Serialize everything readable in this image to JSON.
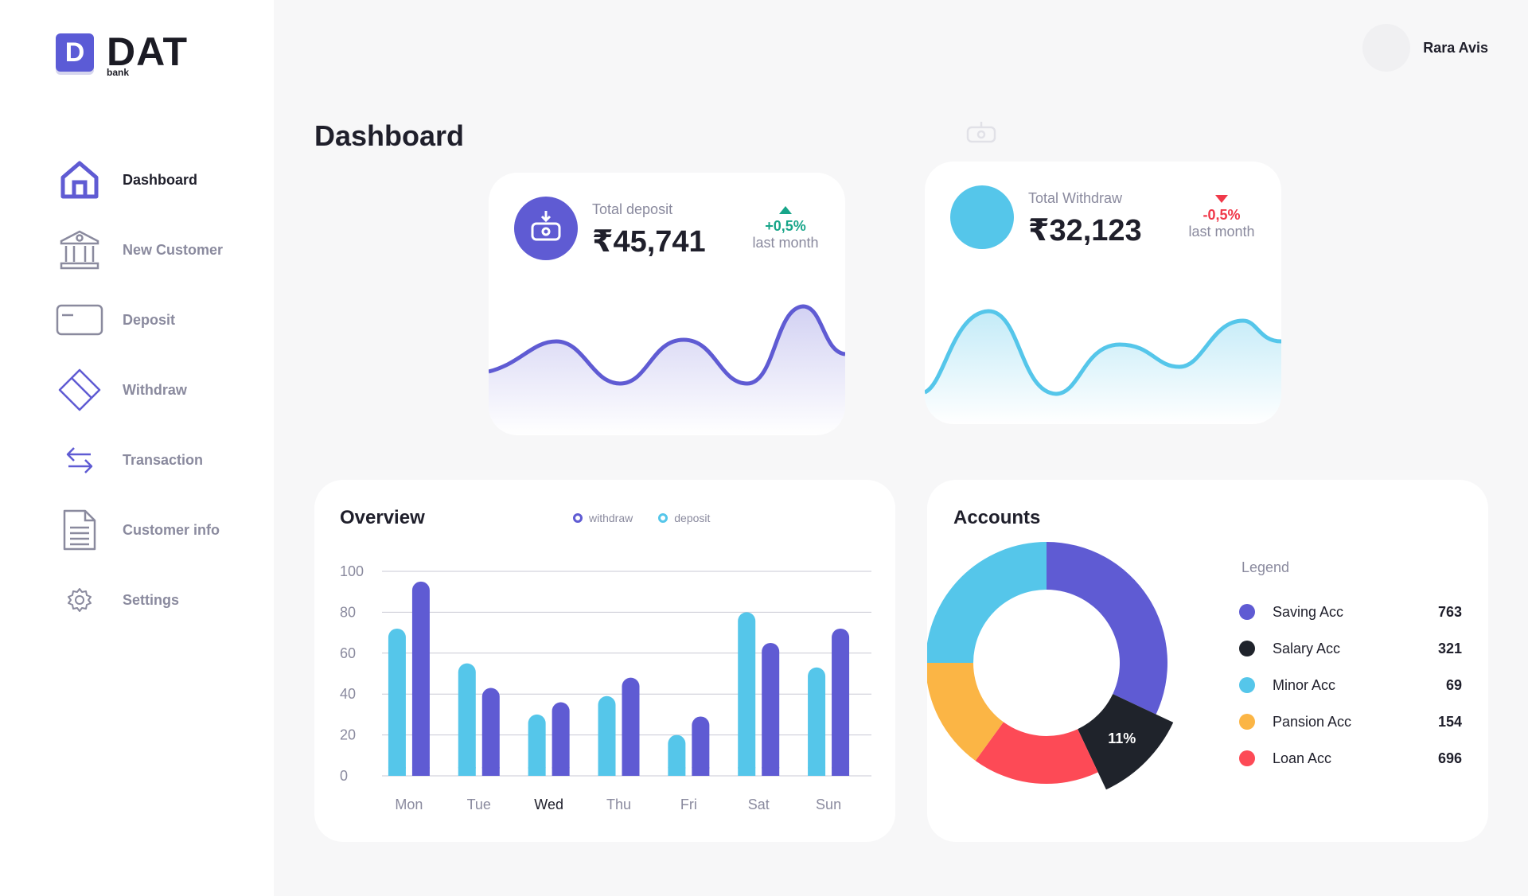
{
  "app": {
    "logo_letter": "D",
    "logo_title": "DAT",
    "logo_sub": "bank"
  },
  "colors": {
    "purple": "#5f5bd3",
    "blue": "#55c6ea",
    "black": "#1f232b",
    "orange": "#fbb545",
    "red": "#fd4a56",
    "green": "#17a589",
    "down": "#f0394a"
  },
  "sidebar": {
    "items": [
      {
        "label": "Dashboard",
        "icon": "home-icon"
      },
      {
        "label": "New Customer",
        "icon": "bank-icon"
      },
      {
        "label": "Deposit",
        "icon": "card-icon"
      },
      {
        "label": "Withdraw",
        "icon": "tag-card-icon"
      },
      {
        "label": "Transaction",
        "icon": "transfer-arrows-icon"
      },
      {
        "label": "Customer info",
        "icon": "document-icon"
      },
      {
        "label": "Settings",
        "icon": "gear-icon"
      }
    ]
  },
  "user": {
    "name": "Rara Avis"
  },
  "page": {
    "title": "Dashboard"
  },
  "deposit": {
    "label": "Total deposit",
    "value": "₹45,741",
    "change": "+0,5%",
    "period": "last month",
    "trend": "up"
  },
  "withdraw": {
    "label": "Total Withdraw",
    "value": "₹32,123",
    "change": "-0,5%",
    "period": "last month",
    "trend": "down"
  },
  "overview": {
    "title": "Overview",
    "legend": {
      "withdraw": "withdraw",
      "deposit": "deposit"
    },
    "chart_data": {
      "type": "bar",
      "categories": [
        "Mon",
        "Tue",
        "Wed",
        "Thu",
        "Fri",
        "Sat",
        "Sun"
      ],
      "series": [
        {
          "name": "deposit",
          "values": [
            72,
            55,
            30,
            39,
            20,
            80,
            53
          ]
        },
        {
          "name": "withdraw",
          "values": [
            95,
            43,
            36,
            48,
            29,
            65,
            72
          ]
        }
      ],
      "yticks": [
        "100",
        "80",
        "60",
        "40",
        "20",
        "0"
      ],
      "ylim": [
        0,
        100
      ],
      "grid": true
    }
  },
  "accounts": {
    "title": "Accounts",
    "legend_title": "Legend",
    "highlight_label": "11%",
    "items": [
      {
        "name": "Saving Acc",
        "value": "763"
      },
      {
        "name": "Salary Acc",
        "value": "321"
      },
      {
        "name": "Minor Acc",
        "value": "69"
      },
      {
        "name": "Pansion Acc",
        "value": "154"
      },
      {
        "name": "Loan Acc",
        "value": "696"
      }
    ],
    "chart_data": {
      "type": "pie",
      "labels": [
        "Saving Acc",
        "Salary Acc",
        "Loan Acc",
        "Pansion Acc",
        "Minor Acc"
      ],
      "values": [
        32,
        11,
        17,
        15,
        25
      ],
      "highlight": "Salary Acc"
    }
  }
}
